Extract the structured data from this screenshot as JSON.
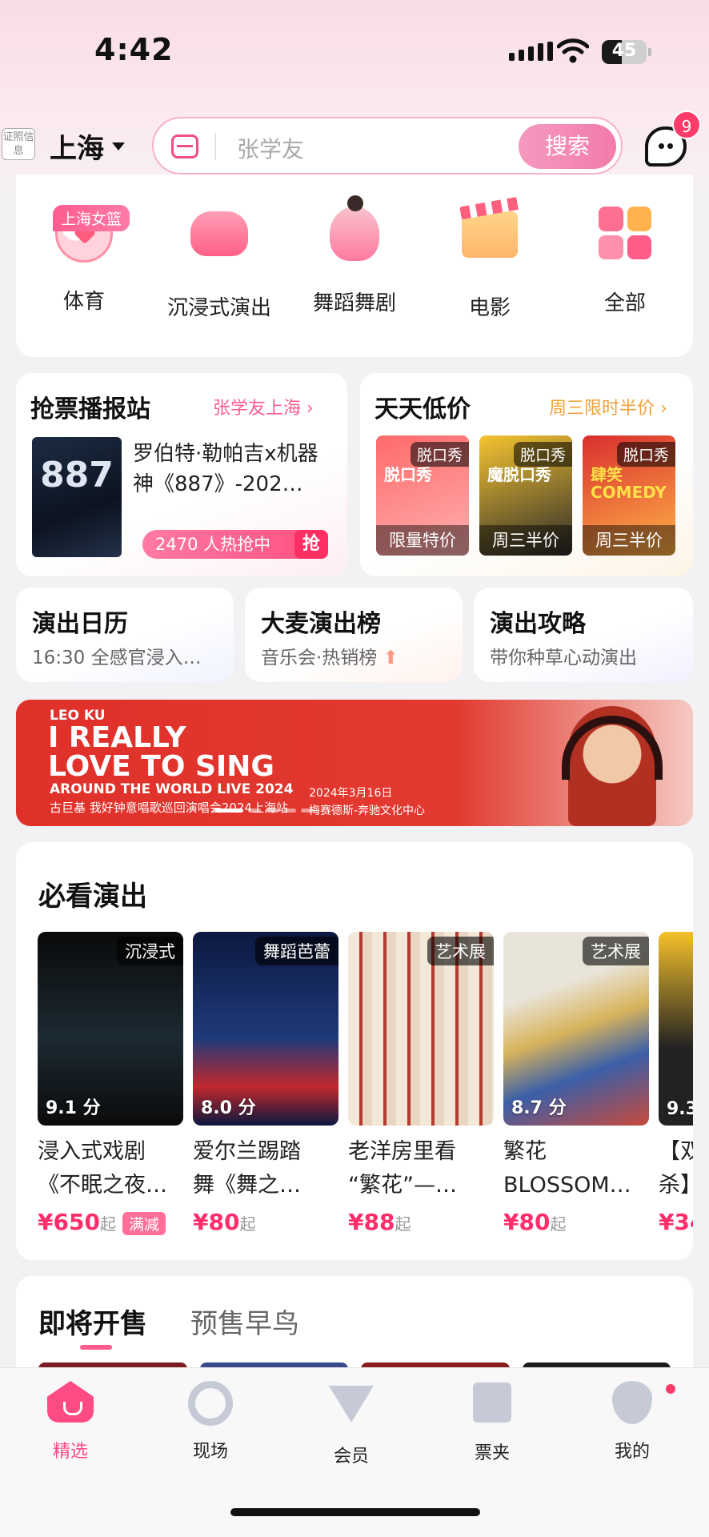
{
  "status_bar": {
    "time": "4:42",
    "battery": "45"
  },
  "header": {
    "cert_label": "证照信息",
    "city": "上海",
    "search_placeholder": "张学友",
    "search_button": "搜索",
    "message_badge": "9"
  },
  "categories": [
    {
      "label": "体育",
      "tag": "上海女篮",
      "icon": "soccer-ball-icon"
    },
    {
      "label": "沉浸式演出",
      "icon": "vr-headset-icon"
    },
    {
      "label": "舞蹈舞剧",
      "icon": "dancer-icon"
    },
    {
      "label": "电影",
      "icon": "clapperboard-icon"
    },
    {
      "label": "全部",
      "icon": "grid-icon"
    }
  ],
  "ticket_station": {
    "title": "抢票播报站",
    "link": "张学友上海",
    "poster_text": "887",
    "show_title": "罗伯特·勒帕吉x机器神《887》-202…",
    "hot_text": "2470 人热抢中",
    "grab": "抢"
  },
  "daily_low": {
    "title": "天天低价",
    "link": "周三限时半价",
    "tiles": [
      {
        "tag": "脱口秀",
        "caption": "限量特价",
        "art": "脱口秀"
      },
      {
        "tag": "脱口秀",
        "caption": "周三半价",
        "art": "魔脱口秀"
      },
      {
        "tag": "脱口秀",
        "caption": "周三半价",
        "art": "肆笑 COMEDY"
      }
    ]
  },
  "mini_cards": [
    {
      "title": "演出日历",
      "sub": "16:30 全感官浸入…"
    },
    {
      "title": "大麦演出榜",
      "sub": "音乐会·热销榜"
    },
    {
      "title": "演出攻略",
      "sub": "带你种草心动演出"
    }
  ],
  "banner": {
    "artist": "LEO KU",
    "headline_1": "I REALLY",
    "headline_2": "LOVE TO SING",
    "tour": "AROUND THE WORLD LIVE 2024",
    "subtitle": "古巨基  我好钟意唱歌巡回演唱会2024上海站",
    "date": "2024年3月16日",
    "venue": "梅赛德斯-奔驰文化中心"
  },
  "must_see": {
    "title": "必看演出",
    "shows": [
      {
        "badge": "沉浸式",
        "score": "9.1 分",
        "name_1": "浸入式戏剧",
        "name_2": "《不眠之夜…",
        "price": "¥650",
        "qi": "起",
        "discount": "满减"
      },
      {
        "badge": "舞蹈芭蕾",
        "score": "8.0 分",
        "name_1": "爱尔兰踢踏",
        "name_2": "舞《舞之…",
        "price": "¥80",
        "qi": "起"
      },
      {
        "badge": "艺术展",
        "score": "",
        "name_1": "老洋房里看",
        "name_2": "“繁花”—…",
        "price": "¥88",
        "qi": "起"
      },
      {
        "badge": "艺术展",
        "score": "8.7 分",
        "name_1": "繁花",
        "name_2": "BLOSSOM…",
        "price": "¥80",
        "qi": "起"
      },
      {
        "badge": "",
        "score": "9.3",
        "name_1": "【双",
        "name_2": "杀】",
        "price": "¥34",
        "qi": ""
      }
    ]
  },
  "upcoming": {
    "tab_1": "即将开售",
    "tab_2": "预售早鸟"
  },
  "tabbar": [
    {
      "label": "精选",
      "icon": "home-icon",
      "active": true
    },
    {
      "label": "现场",
      "icon": "live-icon"
    },
    {
      "label": "会员",
      "icon": "member-icon"
    },
    {
      "label": "票夹",
      "icon": "ticket-icon"
    },
    {
      "label": "我的",
      "icon": "profile-icon"
    }
  ],
  "colors": {
    "accent": "#ff4b84",
    "price": "#ff2d6a",
    "banner_red": "#e0302a"
  }
}
